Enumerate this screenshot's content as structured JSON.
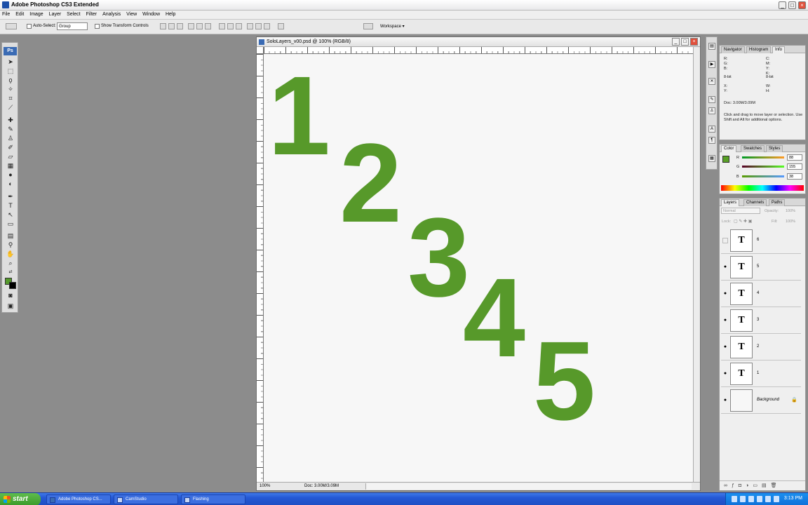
{
  "app": {
    "title": "Adobe Photoshop CS3 Extended",
    "window_buttons": [
      "_",
      "□",
      "×"
    ]
  },
  "menu": [
    "File",
    "Edit",
    "Image",
    "Layer",
    "Select",
    "Filter",
    "Analysis",
    "View",
    "Window",
    "Help"
  ],
  "options_bar": {
    "auto_select_label": "Auto-Select:",
    "auto_select_value": "Group",
    "show_transform_label": "Show Transform Controls",
    "workspace_label": "Workspace ▾"
  },
  "tools": {
    "ps_logo": "Ps",
    "foreground_color": "#55992c",
    "background_color": "#000000"
  },
  "document": {
    "title": "SoloLayers_v00.psd @ 100% (RGB/8)",
    "zoom": "100%",
    "doc_size": "Doc: 3.00M/3.09M",
    "digits": [
      "1",
      "2",
      "3",
      "4",
      "5"
    ],
    "digit_color": "#57992a"
  },
  "info_panel": {
    "tabs": [
      "Navigator",
      "Histogram",
      "Info"
    ],
    "rgb_labels": "R:\nG:\nB:",
    "cmyk_labels": "C:\nM:\nY:\nK:",
    "bit_left": "8-bit",
    "bit_right": "8-bit",
    "xy_labels": "X:\nY:",
    "wh_labels": "W:\nH:",
    "doc_line": "Doc: 3.00M/3.09M",
    "hint": "Click and drag to move layer or selection. Use Shift and Alt for additional options."
  },
  "color_panel": {
    "tabs": [
      "Color",
      "Swatches",
      "Styles"
    ],
    "r_label": "R",
    "g_label": "G",
    "b_label": "B",
    "r_value": "88",
    "g_value": "155",
    "b_value": "38",
    "swatch": "#58a026"
  },
  "layers_panel": {
    "tabs": [
      "Layers",
      "Channels",
      "Paths"
    ],
    "blend_mode": "Normal",
    "opacity_label": "Opacity:",
    "opacity_value": "100%",
    "lock_label": "Lock:",
    "fill_label": "Fill:",
    "fill_value": "100%",
    "layers": [
      {
        "name": "6",
        "visible": false,
        "thumb": "T"
      },
      {
        "name": "5",
        "visible": true,
        "thumb": "T"
      },
      {
        "name": "4",
        "visible": true,
        "thumb": "T"
      },
      {
        "name": "3",
        "visible": true,
        "thumb": "T"
      },
      {
        "name": "2",
        "visible": true,
        "thumb": "T"
      },
      {
        "name": "1",
        "visible": true,
        "thumb": "T"
      },
      {
        "name": "Background",
        "visible": true,
        "thumb": ""
      }
    ]
  },
  "taskbar": {
    "start_label": "start",
    "items": [
      "Adobe Photoshop CS...",
      "CamStudio",
      "Flashing"
    ],
    "time": "3:13 PM"
  }
}
